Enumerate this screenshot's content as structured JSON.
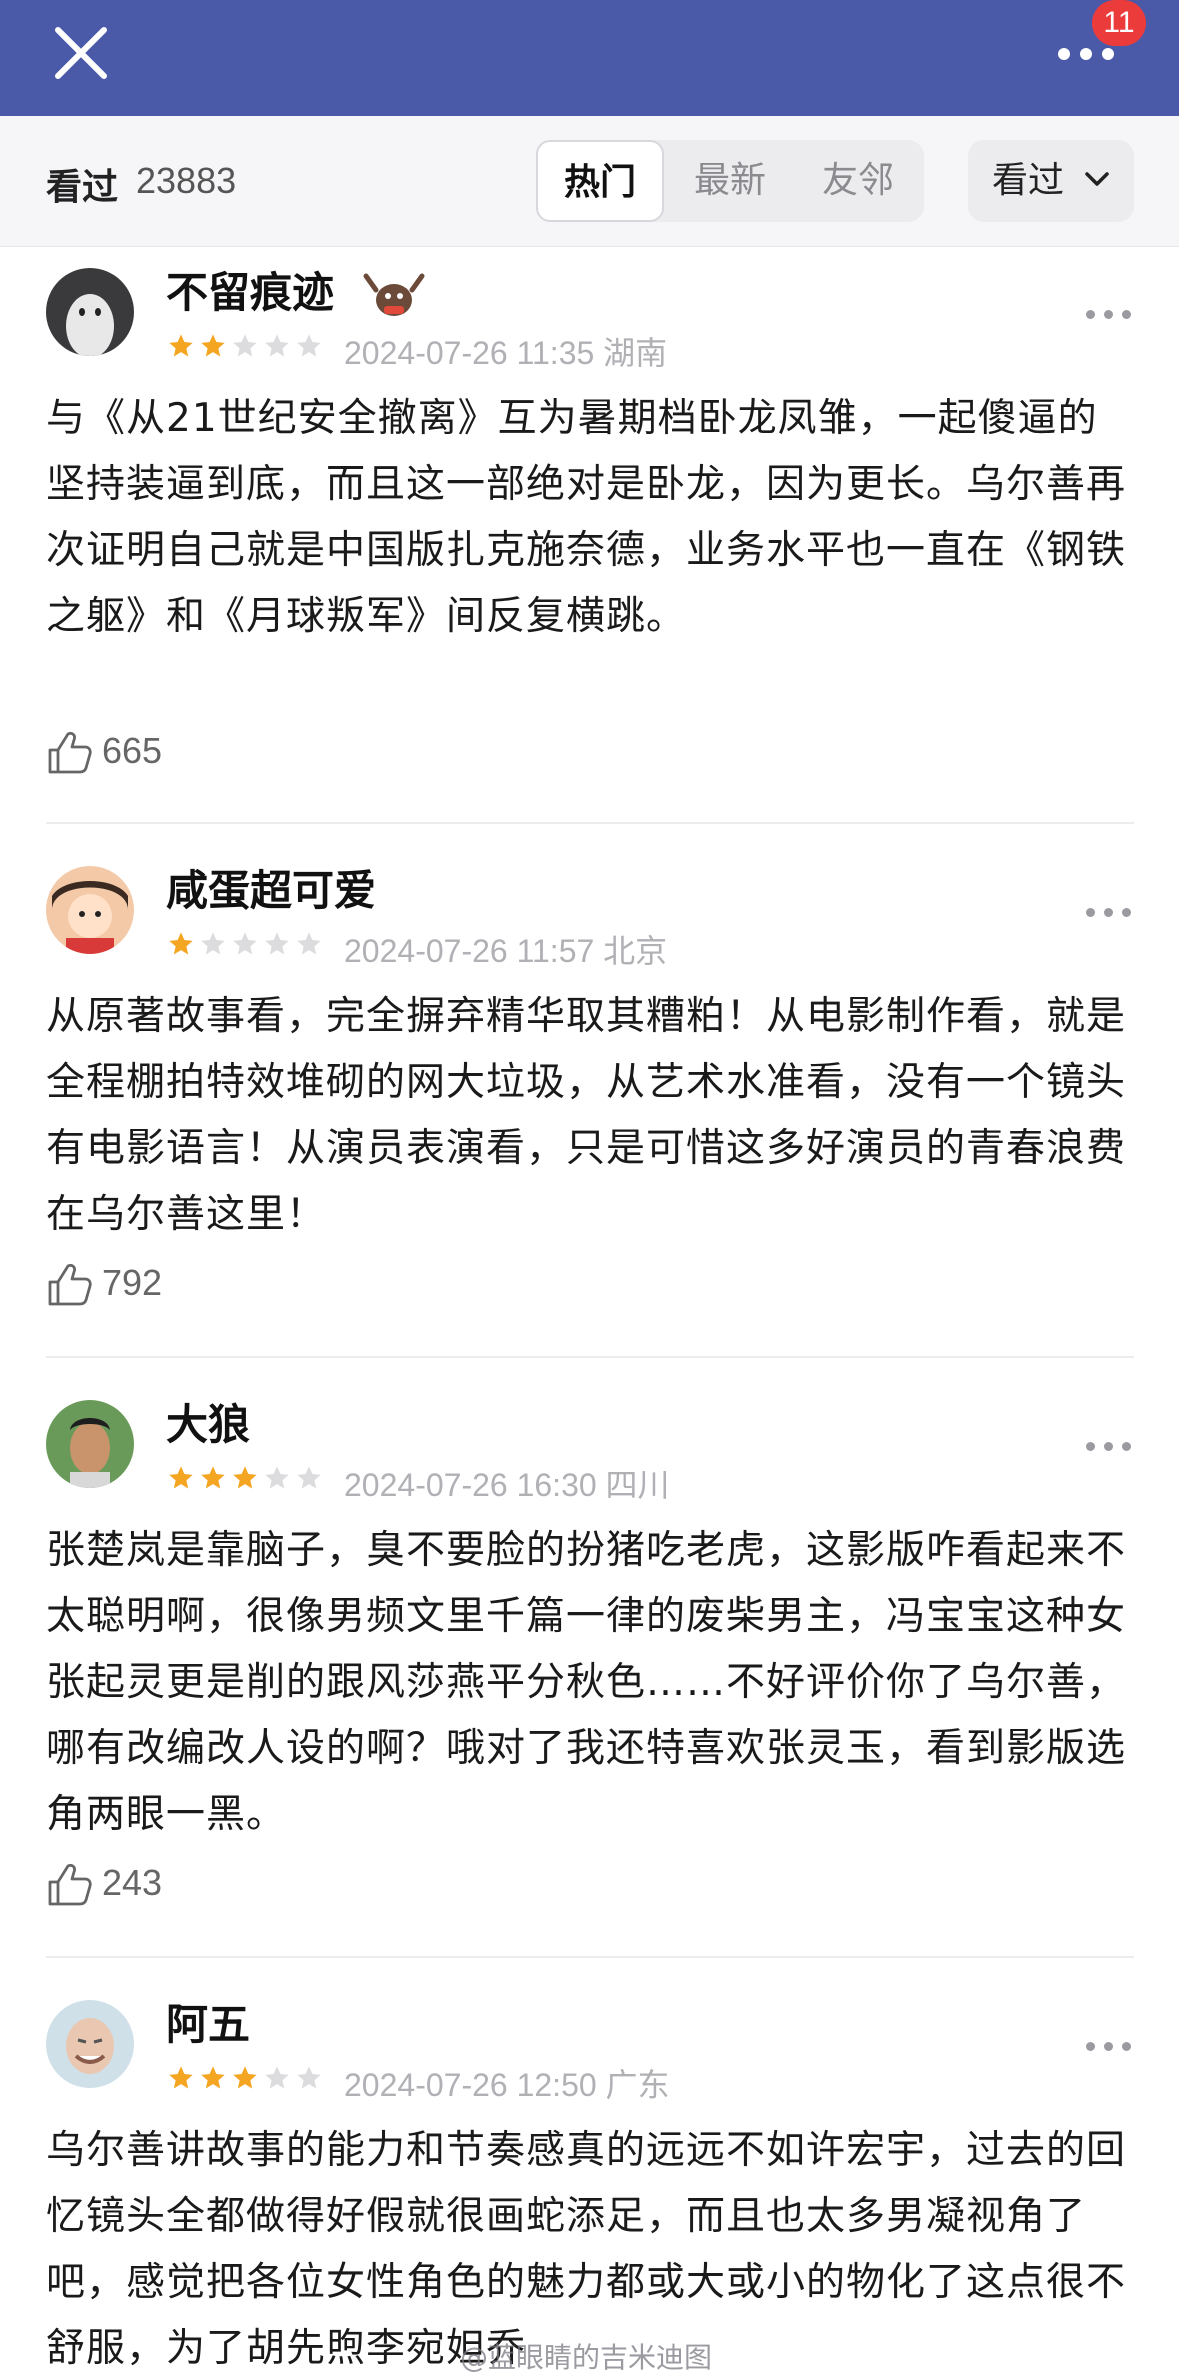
{
  "header": {
    "badge_count": "11"
  },
  "filter": {
    "seen_label": "看过",
    "seen_count": "23883",
    "tabs": [
      {
        "label": "热门",
        "active": true
      },
      {
        "label": "最新",
        "active": false
      },
      {
        "label": "友邻",
        "active": false
      }
    ],
    "dropdown_label": "看过"
  },
  "reviews": [
    {
      "user": "不留痕迹",
      "rating": 2,
      "date": "2024-07-26 11:35",
      "location": "湖南",
      "text": "与《从21世纪安全撤离》互为暑期档卧龙凤雏，一起傻逼的坚持装逼到底，而且这一部绝对是卧龙，因为更长。乌尔善再次证明自己就是中国版扎克施奈德，业务水平也一直在《钢铁之躯》和《月球叛军》间反复横跳。",
      "likes": "665"
    },
    {
      "user": "咸蛋超可爱",
      "rating": 1,
      "date": "2024-07-26 11:57",
      "location": "北京",
      "text": "从原著故事看，完全摒弃精华取其糟粕！从电影制作看，就是全程棚拍特效堆砌的网大垃圾，从艺术水准看，没有一个镜头有电影语言！从演员表演看，只是可惜这多好演员的青春浪费在乌尔善这里！",
      "likes": "792"
    },
    {
      "user": "大狼",
      "rating": 3,
      "date": "2024-07-26 16:30",
      "location": "四川",
      "text": "张楚岚是靠脑子，臭不要脸的扮猪吃老虎，这影版咋看起来不太聪明啊，很像男频文里千篇一律的废柴男主，冯宝宝这种女张起灵更是削的跟风莎燕平分秋色……不好评价你了乌尔善，哪有改编改人设的啊？哦对了我还特喜欢张灵玉，看到影版选角两眼一黑。",
      "likes": "243"
    },
    {
      "user": "阿五",
      "rating": 3,
      "date": "2024-07-26 12:50",
      "location": "广东",
      "text": "乌尔善讲故事的能力和节奏感真的远远不如许宏宇，过去的回忆镜头全都做得好假就很画蛇添足，而且也太多男凝视角了吧，感觉把各位女性角色的魅力都或大或小的物化了这点很不舒服，为了胡先煦李宛妲乔",
      "likes": ""
    }
  ],
  "colors": {
    "header_bg": "#4a5aa8",
    "star_on": "#f4a623",
    "star_off": "#dcdcdf",
    "badge": "#ec3b3b"
  },
  "watermark": "@蓝眼睛的吉米迪图"
}
